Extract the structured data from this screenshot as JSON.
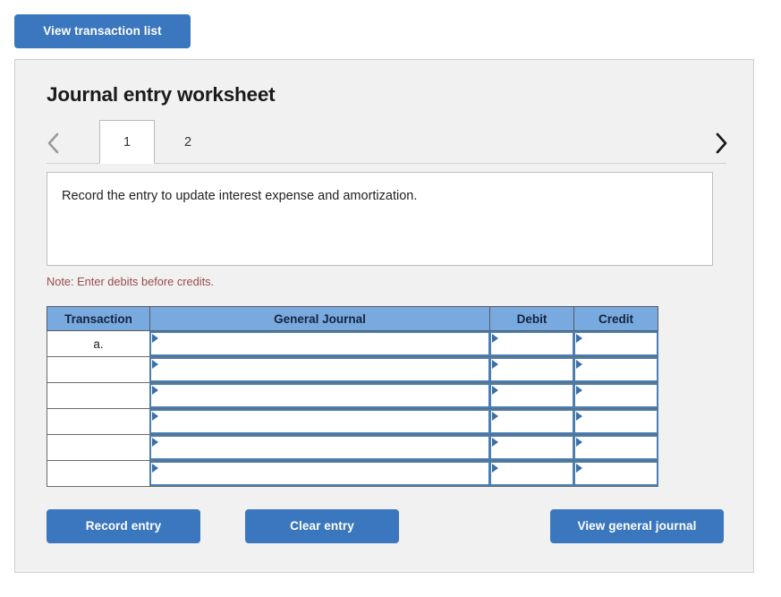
{
  "top": {
    "view_transaction_list_label": "View transaction list"
  },
  "worksheet": {
    "title": "Journal entry worksheet",
    "prev_icon": "chevron-left-icon",
    "next_icon": "chevron-right-icon",
    "tabs": [
      {
        "label": "1",
        "active": true
      },
      {
        "label": "2",
        "active": false
      }
    ],
    "description": "Record the entry to update interest expense and amortization.",
    "note": "Note: Enter debits before credits."
  },
  "table": {
    "headers": [
      "Transaction",
      "General Journal",
      "Debit",
      "Credit"
    ],
    "rows": [
      {
        "transaction": "a.",
        "general_journal": "",
        "debit": "",
        "credit": ""
      },
      {
        "transaction": "",
        "general_journal": "",
        "debit": "",
        "credit": ""
      },
      {
        "transaction": "",
        "general_journal": "",
        "debit": "",
        "credit": ""
      },
      {
        "transaction": "",
        "general_journal": "",
        "debit": "",
        "credit": ""
      },
      {
        "transaction": "",
        "general_journal": "",
        "debit": "",
        "credit": ""
      },
      {
        "transaction": "",
        "general_journal": "",
        "debit": "",
        "credit": ""
      }
    ]
  },
  "actions": {
    "record_entry_label": "Record entry",
    "clear_entry_label": "Clear entry",
    "view_general_journal_label": "View general journal"
  },
  "colors": {
    "button_blue": "#3b77be",
    "header_blue": "#78aae0",
    "note_red": "#9b4b4b",
    "panel_gray": "#f1f1f1",
    "cell_border_blue": "#4a7fb5"
  }
}
